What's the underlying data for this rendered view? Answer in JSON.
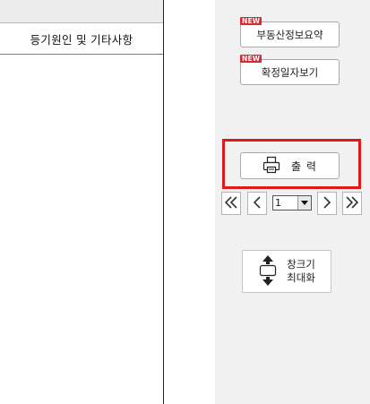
{
  "document": {
    "header_cell": "등기원인 및 기타사항"
  },
  "side_panel": {
    "new_badge": "NEW",
    "summary_button": "부동산정보요약",
    "date_button": "확정일자보기",
    "print_button": "출 력",
    "pager": {
      "current_page": "1"
    },
    "maximize_button": {
      "line1": "창크기",
      "line2": "최대화"
    }
  },
  "colors": {
    "highlight": "#e01818",
    "new_badge": "#d9282f",
    "panel_bg": "#f1f1f1"
  },
  "icons": [
    "printer-icon",
    "first-page-icon",
    "prev-page-icon",
    "dropdown-arrow-icon",
    "next-page-icon",
    "last-page-icon",
    "resize-arrows-icon"
  ]
}
